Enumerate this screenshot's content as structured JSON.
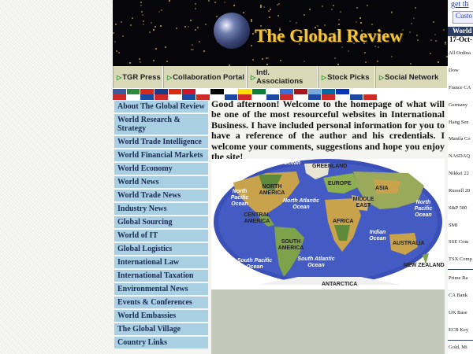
{
  "header": {
    "title": "The Global Review"
  },
  "nav": {
    "items": [
      {
        "label": "TGR Press"
      },
      {
        "label": "Collaboration Portal"
      },
      {
        "label": "Intl. Associations"
      },
      {
        "label": "Stock Picks"
      },
      {
        "label": "Social Network"
      }
    ]
  },
  "flags": {
    "colors": [
      "#3a5ba0",
      "#2e8b3a",
      "#d52b1e",
      "#1b3a8a",
      "#de2910",
      "#cf142b",
      "#ffffff",
      "#000000",
      "#ffffff",
      "#ffdf00",
      "#0a7e3a",
      "#ffffff",
      "#3a6fd8",
      "#aa151b",
      "#75aadb",
      "#006aa7",
      "#0038b8",
      "#ffffff",
      "#ffffff"
    ]
  },
  "menu": {
    "items": [
      "About The Global Review",
      "World Research & Strategy",
      "World Trade Intelligence",
      "World Financial Markets",
      "World Economy",
      "World News",
      "World Trade News",
      "Industry News",
      "Global Sourcing",
      "World of IT",
      "Global Logistics",
      "International Law",
      "International Taxation",
      "Environmental News",
      "Events & Conferences",
      "World Embassies",
      "The Global Village",
      "Country Links"
    ]
  },
  "welcome": {
    "text": "Good afternoon! Welcome to the homepage of what will be one of the most resourceful websites in International Business. I have included personal information for you to have a reference of the author and his credentials. I welcome your comments, suggestions and hope you enjoy the site!"
  },
  "map": {
    "labels": {
      "arctic_ocean_left": "Arctic Ocean",
      "greenland": "GREENLAND",
      "arctic_ocean_right": "Arctic Ocean",
      "north_america": "NORTH AMERICA",
      "europe": "EUROPE",
      "asia": "ASIA",
      "north_pacific_left": "North Pacific Ocean",
      "north_atlantic": "North Atlantic Ocean",
      "middle_east": "MIDDLE EAST",
      "north_pacific_right": "North Pacific Ocean",
      "central_america": "CENTRAL AMERICA",
      "africa": "AFRICA",
      "south_america": "SOUTH AMERICA",
      "indian_ocean": "Indian Ocean",
      "australia": "AUSTRALIA",
      "south_pacific": "South Pacific Ocean",
      "south_atlantic": "South Atlantic Ocean",
      "new_zealand": "NEW ZEALAND",
      "antarctica": "ANTARCTICA"
    }
  },
  "right": {
    "link": "get th",
    "button": "Custo",
    "header": "World",
    "date": "17-Oct-",
    "rows": [
      "All Ordina",
      "Dow",
      "France CA",
      "Germany",
      "Hang Sen",
      "Manila Co",
      "NASDAQ",
      "Nikkei 22",
      "Russell 20",
      "S&P 500",
      "SMI",
      "SSE Com",
      "TSX Comp",
      "Prime Ra",
      "CA Bank",
      "UK Base",
      "ECB Key",
      "Gold, Mi"
    ]
  }
}
